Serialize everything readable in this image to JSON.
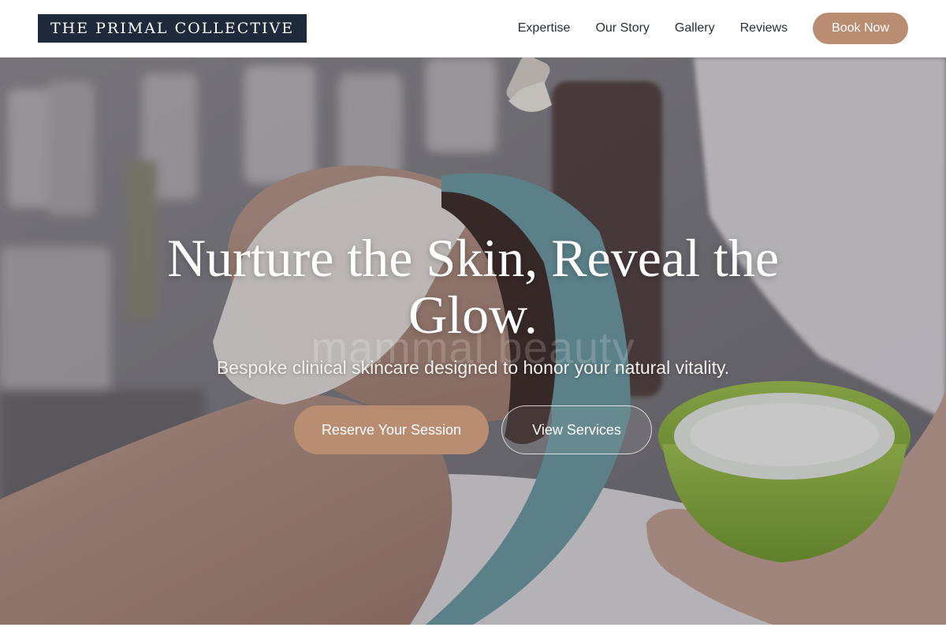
{
  "header": {
    "logo_text": "THE PRIMAL COLLECTIVE",
    "nav": [
      {
        "label": "Expertise"
      },
      {
        "label": "Our Story"
      },
      {
        "label": "Gallery"
      },
      {
        "label": "Reviews"
      }
    ],
    "cta_label": "Book Now"
  },
  "hero": {
    "title": "Nurture the Skin, Reveal the Glow.",
    "watermark": "mammal beauty",
    "subtitle": "Bespoke clinical skincare designed to honor your natural vitality.",
    "primary_cta": "Reserve Your Session",
    "secondary_cta": "View Services"
  },
  "colors": {
    "brand_navy": "#1e2a3b",
    "accent_tan": "#b98d72"
  }
}
